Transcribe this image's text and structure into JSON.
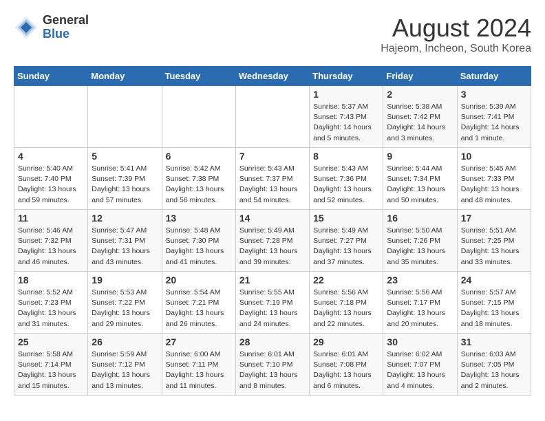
{
  "logo": {
    "general": "General",
    "blue": "Blue"
  },
  "title": "August 2024",
  "subtitle": "Hajeom, Incheon, South Korea",
  "days_of_week": [
    "Sunday",
    "Monday",
    "Tuesday",
    "Wednesday",
    "Thursday",
    "Friday",
    "Saturday"
  ],
  "weeks": [
    [
      {
        "day": "",
        "info": ""
      },
      {
        "day": "",
        "info": ""
      },
      {
        "day": "",
        "info": ""
      },
      {
        "day": "",
        "info": ""
      },
      {
        "day": "1",
        "info": "Sunrise: 5:37 AM\nSunset: 7:43 PM\nDaylight: 14 hours\nand 5 minutes."
      },
      {
        "day": "2",
        "info": "Sunrise: 5:38 AM\nSunset: 7:42 PM\nDaylight: 14 hours\nand 3 minutes."
      },
      {
        "day": "3",
        "info": "Sunrise: 5:39 AM\nSunset: 7:41 PM\nDaylight: 14 hours\nand 1 minute."
      }
    ],
    [
      {
        "day": "4",
        "info": "Sunrise: 5:40 AM\nSunset: 7:40 PM\nDaylight: 13 hours\nand 59 minutes."
      },
      {
        "day": "5",
        "info": "Sunrise: 5:41 AM\nSunset: 7:39 PM\nDaylight: 13 hours\nand 57 minutes."
      },
      {
        "day": "6",
        "info": "Sunrise: 5:42 AM\nSunset: 7:38 PM\nDaylight: 13 hours\nand 56 minutes."
      },
      {
        "day": "7",
        "info": "Sunrise: 5:43 AM\nSunset: 7:37 PM\nDaylight: 13 hours\nand 54 minutes."
      },
      {
        "day": "8",
        "info": "Sunrise: 5:43 AM\nSunset: 7:36 PM\nDaylight: 13 hours\nand 52 minutes."
      },
      {
        "day": "9",
        "info": "Sunrise: 5:44 AM\nSunset: 7:34 PM\nDaylight: 13 hours\nand 50 minutes."
      },
      {
        "day": "10",
        "info": "Sunrise: 5:45 AM\nSunset: 7:33 PM\nDaylight: 13 hours\nand 48 minutes."
      }
    ],
    [
      {
        "day": "11",
        "info": "Sunrise: 5:46 AM\nSunset: 7:32 PM\nDaylight: 13 hours\nand 46 minutes."
      },
      {
        "day": "12",
        "info": "Sunrise: 5:47 AM\nSunset: 7:31 PM\nDaylight: 13 hours\nand 43 minutes."
      },
      {
        "day": "13",
        "info": "Sunrise: 5:48 AM\nSunset: 7:30 PM\nDaylight: 13 hours\nand 41 minutes."
      },
      {
        "day": "14",
        "info": "Sunrise: 5:49 AM\nSunset: 7:28 PM\nDaylight: 13 hours\nand 39 minutes."
      },
      {
        "day": "15",
        "info": "Sunrise: 5:49 AM\nSunset: 7:27 PM\nDaylight: 13 hours\nand 37 minutes."
      },
      {
        "day": "16",
        "info": "Sunrise: 5:50 AM\nSunset: 7:26 PM\nDaylight: 13 hours\nand 35 minutes."
      },
      {
        "day": "17",
        "info": "Sunrise: 5:51 AM\nSunset: 7:25 PM\nDaylight: 13 hours\nand 33 minutes."
      }
    ],
    [
      {
        "day": "18",
        "info": "Sunrise: 5:52 AM\nSunset: 7:23 PM\nDaylight: 13 hours\nand 31 minutes."
      },
      {
        "day": "19",
        "info": "Sunrise: 5:53 AM\nSunset: 7:22 PM\nDaylight: 13 hours\nand 29 minutes."
      },
      {
        "day": "20",
        "info": "Sunrise: 5:54 AM\nSunset: 7:21 PM\nDaylight: 13 hours\nand 26 minutes."
      },
      {
        "day": "21",
        "info": "Sunrise: 5:55 AM\nSunset: 7:19 PM\nDaylight: 13 hours\nand 24 minutes."
      },
      {
        "day": "22",
        "info": "Sunrise: 5:56 AM\nSunset: 7:18 PM\nDaylight: 13 hours\nand 22 minutes."
      },
      {
        "day": "23",
        "info": "Sunrise: 5:56 AM\nSunset: 7:17 PM\nDaylight: 13 hours\nand 20 minutes."
      },
      {
        "day": "24",
        "info": "Sunrise: 5:57 AM\nSunset: 7:15 PM\nDaylight: 13 hours\nand 18 minutes."
      }
    ],
    [
      {
        "day": "25",
        "info": "Sunrise: 5:58 AM\nSunset: 7:14 PM\nDaylight: 13 hours\nand 15 minutes."
      },
      {
        "day": "26",
        "info": "Sunrise: 5:59 AM\nSunset: 7:12 PM\nDaylight: 13 hours\nand 13 minutes."
      },
      {
        "day": "27",
        "info": "Sunrise: 6:00 AM\nSunset: 7:11 PM\nDaylight: 13 hours\nand 11 minutes."
      },
      {
        "day": "28",
        "info": "Sunrise: 6:01 AM\nSunset: 7:10 PM\nDaylight: 13 hours\nand 8 minutes."
      },
      {
        "day": "29",
        "info": "Sunrise: 6:01 AM\nSunset: 7:08 PM\nDaylight: 13 hours\nand 6 minutes."
      },
      {
        "day": "30",
        "info": "Sunrise: 6:02 AM\nSunset: 7:07 PM\nDaylight: 13 hours\nand 4 minutes."
      },
      {
        "day": "31",
        "info": "Sunrise: 6:03 AM\nSunset: 7:05 PM\nDaylight: 13 hours\nand 2 minutes."
      }
    ]
  ]
}
